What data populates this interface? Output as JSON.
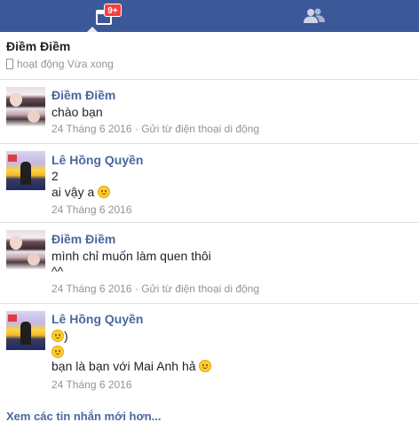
{
  "topbar": {
    "messages_badge": "9+",
    "messages_icon": "calendar-messages-icon",
    "friends_icon": "friends-icon",
    "bar_color": "#3b5998",
    "badge_color": "#fa3e3e"
  },
  "conversation": {
    "title": "Điềm Điềm",
    "status": "hoạt động Vừa xong"
  },
  "messages": [
    {
      "sender": "Điềm Điềm",
      "lines": [
        "chào bạn"
      ],
      "date": "24 Tháng 6 2016",
      "separator": " · ",
      "source": "Gửi từ điện thoại di động"
    },
    {
      "sender": "Lê Hồng Quyền",
      "lines": [
        "2",
        "ai vậy a"
      ],
      "date": "24 Tháng 6 2016"
    },
    {
      "sender": "Điềm Điềm",
      "lines": [
        "mình chỉ muốn làm quen thôi",
        "^^"
      ],
      "date": "24 Tháng 6 2016",
      "separator": " · ",
      "source": "Gửi từ điện thoại di động"
    },
    {
      "sender": "Lê Hồng Quyền",
      "lines": [
        ")",
        "",
        "bạn là bạn với Mai Anh hả"
      ],
      "date": "24 Tháng 6 2016"
    }
  ],
  "footer": {
    "more_link": "Xem các tin nhắn mới hơn..."
  },
  "colors": {
    "sender_name": "#4b67a1",
    "meta_text": "#90949c",
    "divider": "#dddfe2"
  }
}
